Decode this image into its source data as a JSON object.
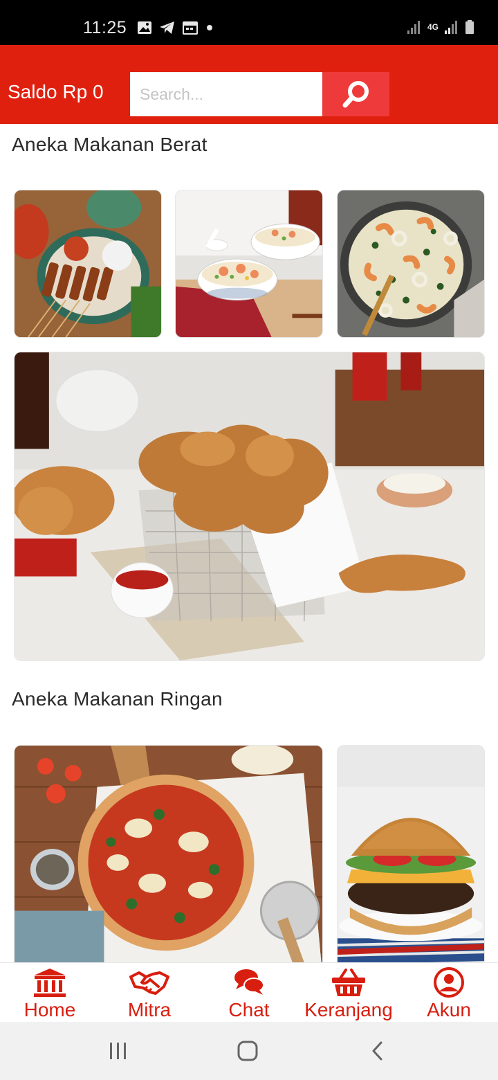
{
  "status_bar": {
    "time": "11:25",
    "left_icons": [
      "image-icon",
      "telegram-icon",
      "calendar-icon",
      "dot-icon"
    ],
    "right_icons": [
      "signal-icon",
      "network-4g-icon",
      "signal-icon",
      "battery-icon"
    ],
    "network_label": "4G"
  },
  "header": {
    "balance_label": "Saldo Rp 0",
    "search_placeholder": "Search...",
    "search_icon": "search-icon",
    "background_color": "#e0200f",
    "search_button_color": "#ee3a3a"
  },
  "sections": [
    {
      "title": "Aneka Makanan Berat",
      "tiles": [
        "satay",
        "shrimp-fried-rice",
        "seafood-pan",
        "fried-chicken"
      ]
    },
    {
      "title": "Aneka Makanan Ringan",
      "tiles": [
        "pizza",
        "burger"
      ]
    }
  ],
  "bottom_nav": {
    "accent_color": "#d81e0f",
    "items": [
      {
        "label": "Home",
        "icon": "bank-icon"
      },
      {
        "label": "Mitra",
        "icon": "handshake-icon"
      },
      {
        "label": "Chat",
        "icon": "chat-icon"
      },
      {
        "label": "Keranjang",
        "icon": "basket-icon"
      },
      {
        "label": "Akun",
        "icon": "account-icon"
      }
    ]
  },
  "system_nav": [
    "recent-apps-icon",
    "home-icon",
    "back-icon"
  ]
}
